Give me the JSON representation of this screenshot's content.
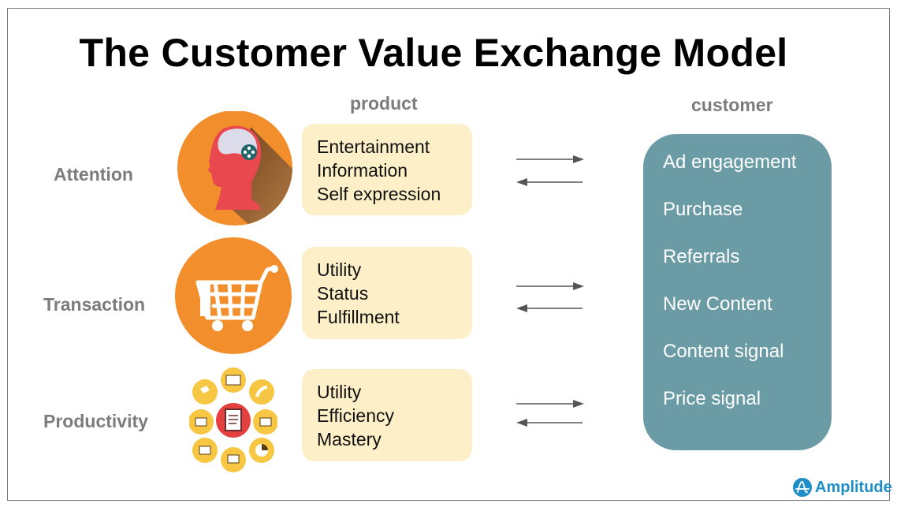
{
  "title": "The Customer Value Exchange Model",
  "columns": {
    "product": "product",
    "customer": "customer"
  },
  "rows": [
    {
      "label": "Attention",
      "icon": "head-brain-icon",
      "items": [
        "Entertainment",
        "Information",
        "Self expression"
      ]
    },
    {
      "label": "Transaction",
      "icon": "shopping-cart-icon",
      "items": [
        "Utility",
        "Status",
        "Fulfillment"
      ]
    },
    {
      "label": "Productivity",
      "icon": "productivity-tools-icon",
      "items": [
        "Utility",
        "Efficiency",
        "Mastery"
      ]
    }
  ],
  "customer_items": [
    "Ad engagement",
    "Purchase",
    "Referrals",
    "New Content",
    "Content signal",
    "Price signal"
  ],
  "logo": {
    "icon": "amplitude-logo-icon",
    "text": "Amplitude"
  },
  "colors": {
    "orange": "#f28f2c",
    "product_box": "#fdefc7",
    "customer_box": "#6b9ca6",
    "label_gray": "#7c7c7c",
    "brand_blue": "#1f8ec6"
  }
}
